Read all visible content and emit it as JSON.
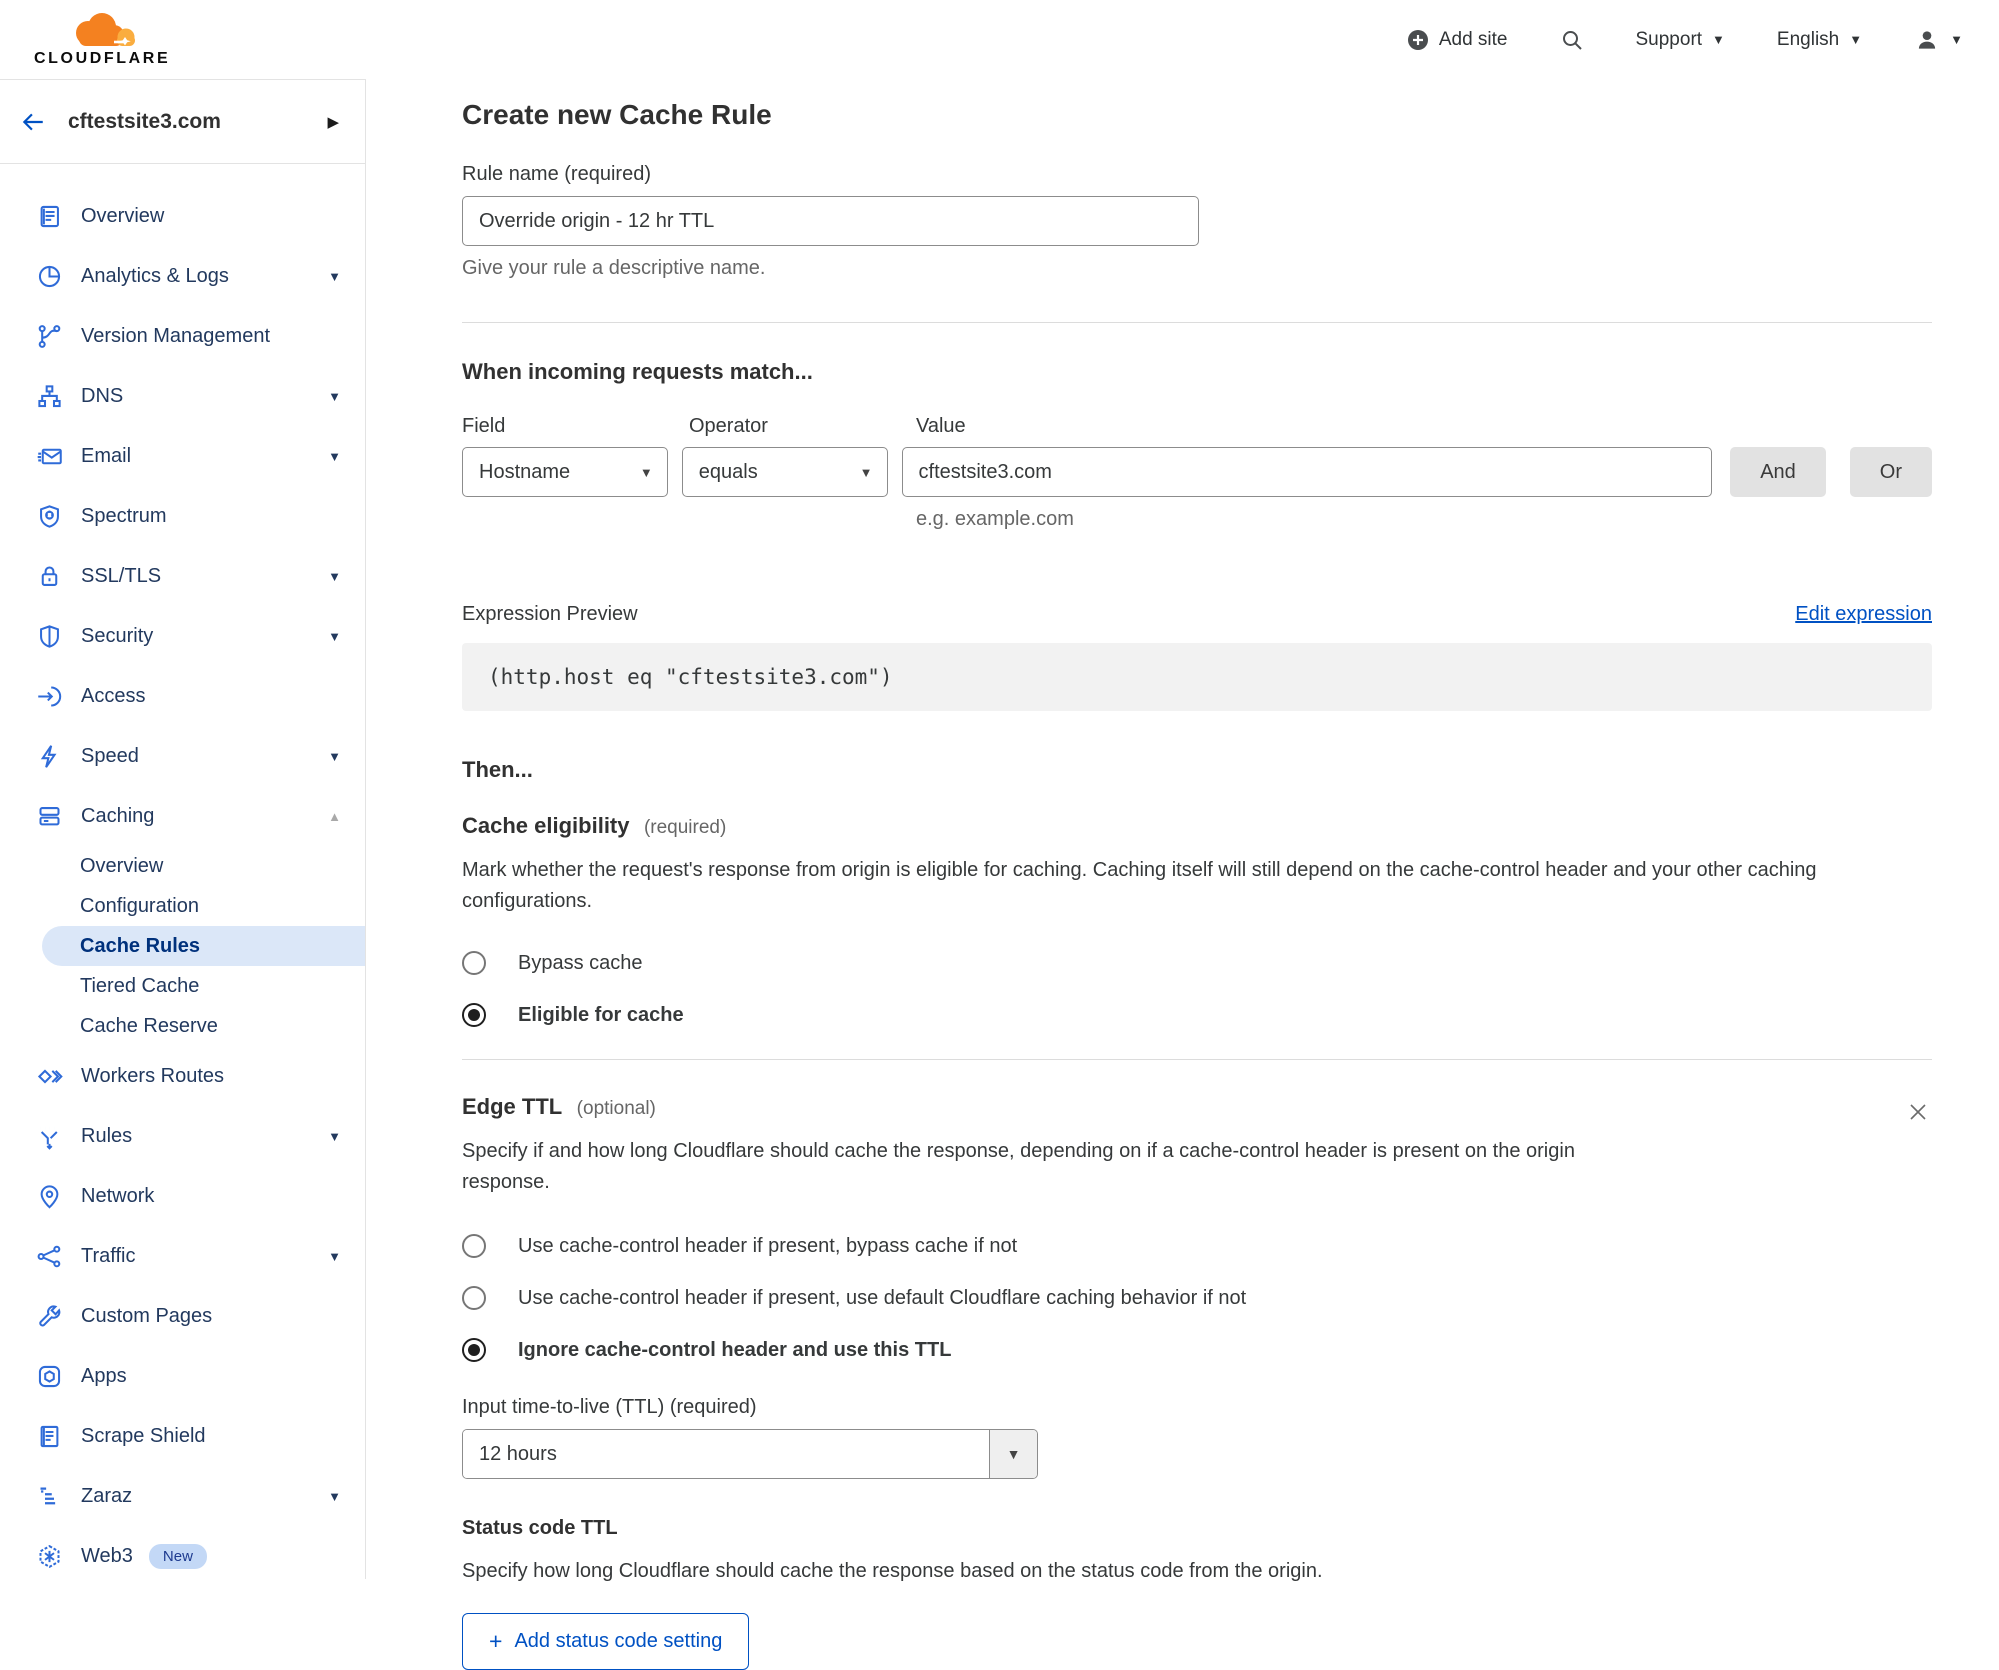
{
  "header": {
    "brand": "CLOUDFLARE",
    "add_site": "Add site",
    "support": "Support",
    "language": "English"
  },
  "sidebar": {
    "site": "cftestsite3.com",
    "items": [
      {
        "label": "Overview"
      },
      {
        "label": "Analytics & Logs"
      },
      {
        "label": "Version Management"
      },
      {
        "label": "DNS"
      },
      {
        "label": "Email"
      },
      {
        "label": "Spectrum"
      },
      {
        "label": "SSL/TLS"
      },
      {
        "label": "Security"
      },
      {
        "label": "Access"
      },
      {
        "label": "Speed"
      },
      {
        "label": "Caching"
      },
      {
        "label": "Workers Routes"
      },
      {
        "label": "Rules"
      },
      {
        "label": "Network"
      },
      {
        "label": "Traffic"
      },
      {
        "label": "Custom Pages"
      },
      {
        "label": "Apps"
      },
      {
        "label": "Scrape Shield"
      },
      {
        "label": "Zaraz"
      },
      {
        "label": "Web3"
      }
    ],
    "caching_sub": [
      {
        "label": "Overview"
      },
      {
        "label": "Configuration"
      },
      {
        "label": "Cache Rules"
      },
      {
        "label": "Tiered Cache"
      },
      {
        "label": "Cache Reserve"
      }
    ],
    "web3_badge": "New"
  },
  "main": {
    "title": "Create new Cache Rule",
    "rule_name": {
      "label": "Rule name (required)",
      "value": "Override origin - 12 hr TTL",
      "help": "Give your rule a descriptive name."
    },
    "match": {
      "heading": "When incoming requests match...",
      "field_label": "Field",
      "field_value": "Hostname",
      "operator_label": "Operator",
      "operator_value": "equals",
      "value_label": "Value",
      "value_value": "cftestsite3.com",
      "value_help": "e.g. example.com",
      "and_label": "And",
      "or_label": "Or"
    },
    "expression": {
      "label": "Expression Preview",
      "edit_link": "Edit expression",
      "code": "(http.host eq \"cftestsite3.com\")"
    },
    "then_heading": "Then...",
    "cache_eligibility": {
      "heading": "Cache eligibility",
      "tag": "(required)",
      "description": "Mark whether the request's response from origin is eligible for caching. Caching itself will still depend on the cache-control header and your other caching configurations.",
      "options": [
        {
          "label": "Bypass cache",
          "selected": false
        },
        {
          "label": "Eligible for cache",
          "selected": true
        }
      ]
    },
    "edge_ttl": {
      "heading": "Edge TTL",
      "tag": "(optional)",
      "description": "Specify if and how long Cloudflare should cache the response, depending on if a cache-control header is present on the origin response.",
      "options": [
        {
          "label": "Use cache-control header if present, bypass cache if not",
          "selected": false
        },
        {
          "label": "Use cache-control header if present, use default Cloudflare caching behavior if not",
          "selected": false
        },
        {
          "label": "Ignore cache-control header and use this TTL",
          "selected": true
        }
      ],
      "ttl_label": "Input time-to-live (TTL) (required)",
      "ttl_value": "12 hours",
      "status_heading": "Status code TTL",
      "status_description": "Specify how long Cloudflare should cache the response based on the status code from the origin.",
      "add_button": "Add status code setting"
    }
  },
  "colors": {
    "accent_link": "#0051c3",
    "icon_blue": "#2f6bd8",
    "nav_text": "#22395e",
    "brand_orange": "#f48120",
    "brand_orange_light": "#faad3f",
    "active_item_bg": "#dbe7f8",
    "code_bg": "#f2f2f2"
  }
}
